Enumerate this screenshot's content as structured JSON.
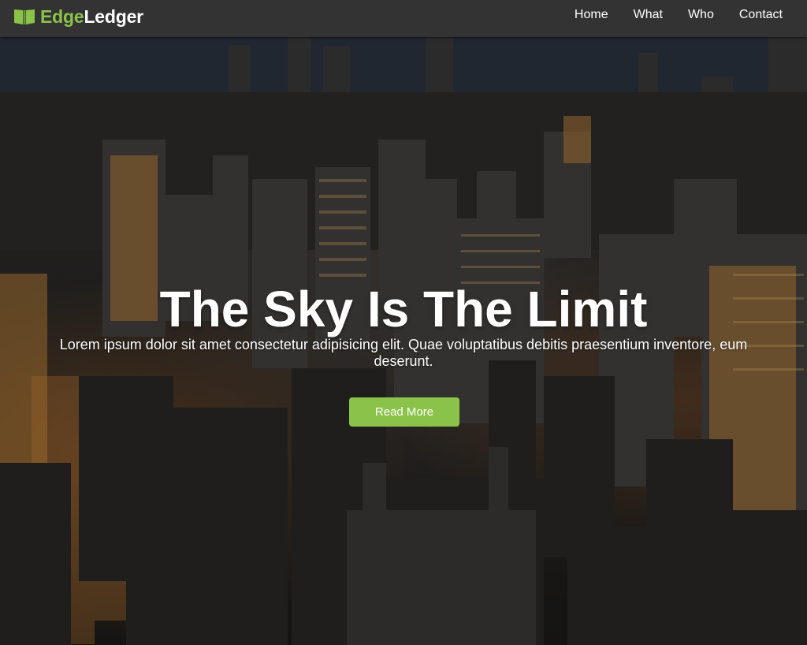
{
  "navbar": {
    "brand_accent": "Edge",
    "brand_main": "Ledger",
    "brand_icon": "open-book-icon",
    "links": [
      {
        "label": "Home"
      },
      {
        "label": "What"
      },
      {
        "label": "Who"
      },
      {
        "label": "Contact"
      }
    ]
  },
  "hero": {
    "background": "night city skyline aerial photo",
    "title": "The Sky Is The Limit",
    "subtitle": "Lorem ipsum dolor sit amet consectetur adipisicing elit. Quae voluptatibus debitis praesentium inventore, eum deserunt.",
    "button_label": "Read More"
  },
  "colors": {
    "accent": "#8bc34a",
    "navbar_bg": "#333333",
    "text": "#ffffff"
  }
}
